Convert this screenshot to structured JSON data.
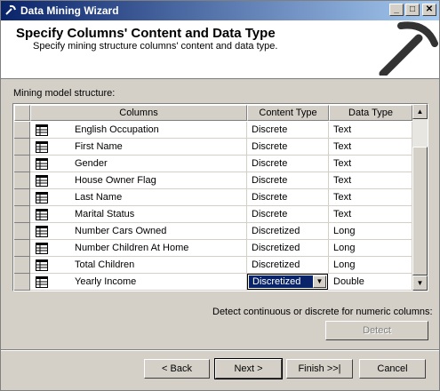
{
  "window": {
    "title": "Data Mining Wizard",
    "buttons": {
      "minimize": "_",
      "maximize": "□",
      "close": "✕"
    }
  },
  "header": {
    "title": "Specify Columns' Content and Data Type",
    "subtitle": "Specify mining structure columns' content and data type."
  },
  "structure_label": "Mining model structure:",
  "grid": {
    "columns": [
      "Columns",
      "Content Type",
      "Data Type"
    ],
    "rows": [
      {
        "name": "English Occupation",
        "content": "Discrete",
        "type": "Text"
      },
      {
        "name": "First Name",
        "content": "Discrete",
        "type": "Text"
      },
      {
        "name": "Gender",
        "content": "Discrete",
        "type": "Text"
      },
      {
        "name": "House Owner Flag",
        "content": "Discrete",
        "type": "Text"
      },
      {
        "name": "Last Name",
        "content": "Discrete",
        "type": "Text"
      },
      {
        "name": "Marital Status",
        "content": "Discrete",
        "type": "Text"
      },
      {
        "name": "Number Cars Owned",
        "content": "Discretized",
        "type": "Long"
      },
      {
        "name": "Number Children At Home",
        "content": "Discretized",
        "type": "Long"
      },
      {
        "name": "Total Children",
        "content": "Discretized",
        "type": "Long"
      },
      {
        "name": "Yearly Income",
        "content": "Discretized",
        "type": "Double"
      }
    ],
    "selected_content": "Discretized"
  },
  "detect": {
    "label": "Detect continuous or discrete for numeric columns:",
    "button": "Detect"
  },
  "nav": {
    "back": "< Back",
    "next": "Next >",
    "finish": "Finish >>|",
    "cancel": "Cancel"
  }
}
